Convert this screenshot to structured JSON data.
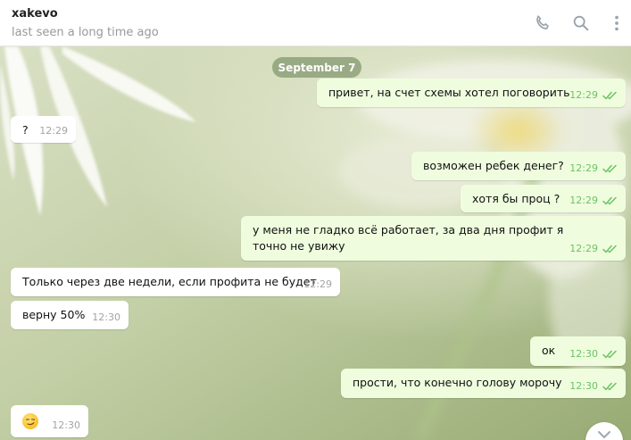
{
  "header": {
    "chat_name": "xakevo",
    "status": "last seen a long time ago",
    "icons": [
      "phone-icon",
      "search-icon",
      "more-vertical-icon"
    ]
  },
  "date_separator": "September 7",
  "colors": {
    "outgoing_bubble": "#effdde",
    "incoming_bubble": "#ffffff",
    "read_time": "#6cc264",
    "incoming_time": "#a4a4a4"
  },
  "messages": [
    {
      "direction": "out",
      "text": "привет, на счет схемы хотел поговорить",
      "time": "12:29",
      "status": "read"
    },
    {
      "direction": "in",
      "text": "?",
      "time": "12:29"
    },
    {
      "direction": "out",
      "text": "возможен ребек денег?",
      "time": "12:29",
      "status": "read"
    },
    {
      "direction": "out",
      "text": "хотя бы проц ?",
      "time": "12:29",
      "status": "read"
    },
    {
      "direction": "out",
      "text": "у меня не гладко всё работает, за два дня профит я точно не увижу",
      "time": "12:29",
      "status": "read"
    },
    {
      "direction": "in",
      "text": "Только через две недели, если профита не будет",
      "time": "12:29"
    },
    {
      "direction": "in",
      "text": "верну 50%",
      "time": "12:30"
    },
    {
      "direction": "out",
      "text": "ок",
      "time": "12:30",
      "status": "read"
    },
    {
      "direction": "out",
      "text": "прости, что конечно голову морочу",
      "time": "12:30",
      "status": "read"
    },
    {
      "direction": "in",
      "emoji": "smirking-face-emoji",
      "time": "12:30"
    }
  ]
}
